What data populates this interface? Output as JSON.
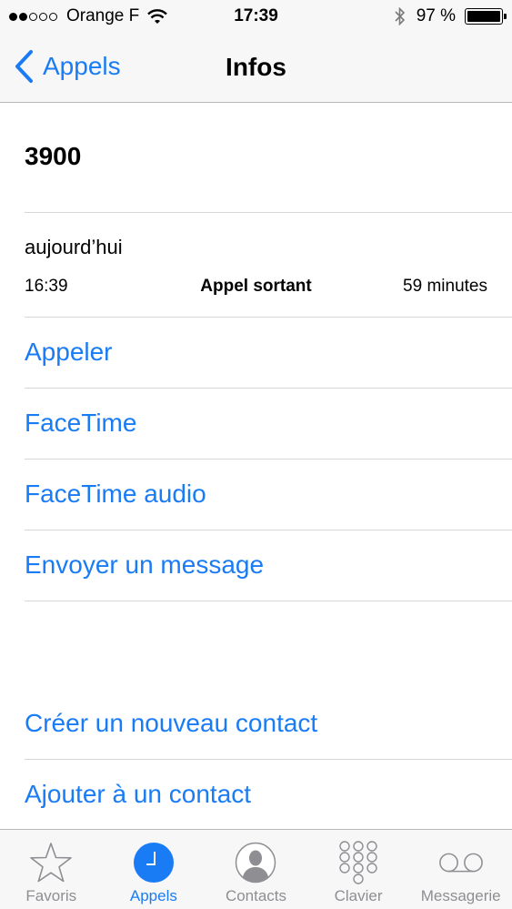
{
  "status_bar": {
    "carrier": "Orange F",
    "signal_bars": 2,
    "signal_total": 5,
    "time": "17:39",
    "battery": "97 %",
    "battery_level": 0.97
  },
  "nav": {
    "back_label": "Appels",
    "title": "Infos"
  },
  "contact": {
    "number": "3900"
  },
  "call": {
    "date": "aujourd’hui",
    "time": "16:39",
    "type": "Appel sortant",
    "duration": "59 minutes"
  },
  "actions": [
    {
      "label": "Appeler"
    },
    {
      "label": "FaceTime"
    },
    {
      "label": "FaceTime audio"
    },
    {
      "label": "Envoyer un message"
    }
  ],
  "contact_actions": [
    {
      "label": "Créer un nouveau contact"
    },
    {
      "label": "Ajouter à un contact"
    }
  ],
  "tabs": [
    {
      "label": "Favoris",
      "icon": "star-icon",
      "active": false
    },
    {
      "label": "Appels",
      "icon": "clock-icon",
      "active": true
    },
    {
      "label": "Contacts",
      "icon": "contact-icon",
      "active": false
    },
    {
      "label": "Clavier",
      "icon": "keypad-icon",
      "active": false
    },
    {
      "label": "Messagerie",
      "icon": "voicemail-icon",
      "active": false
    }
  ],
  "colors": {
    "accent": "#1a7cf5",
    "inactive": "#8e8e93",
    "bar_background": "#f7f7f7"
  }
}
